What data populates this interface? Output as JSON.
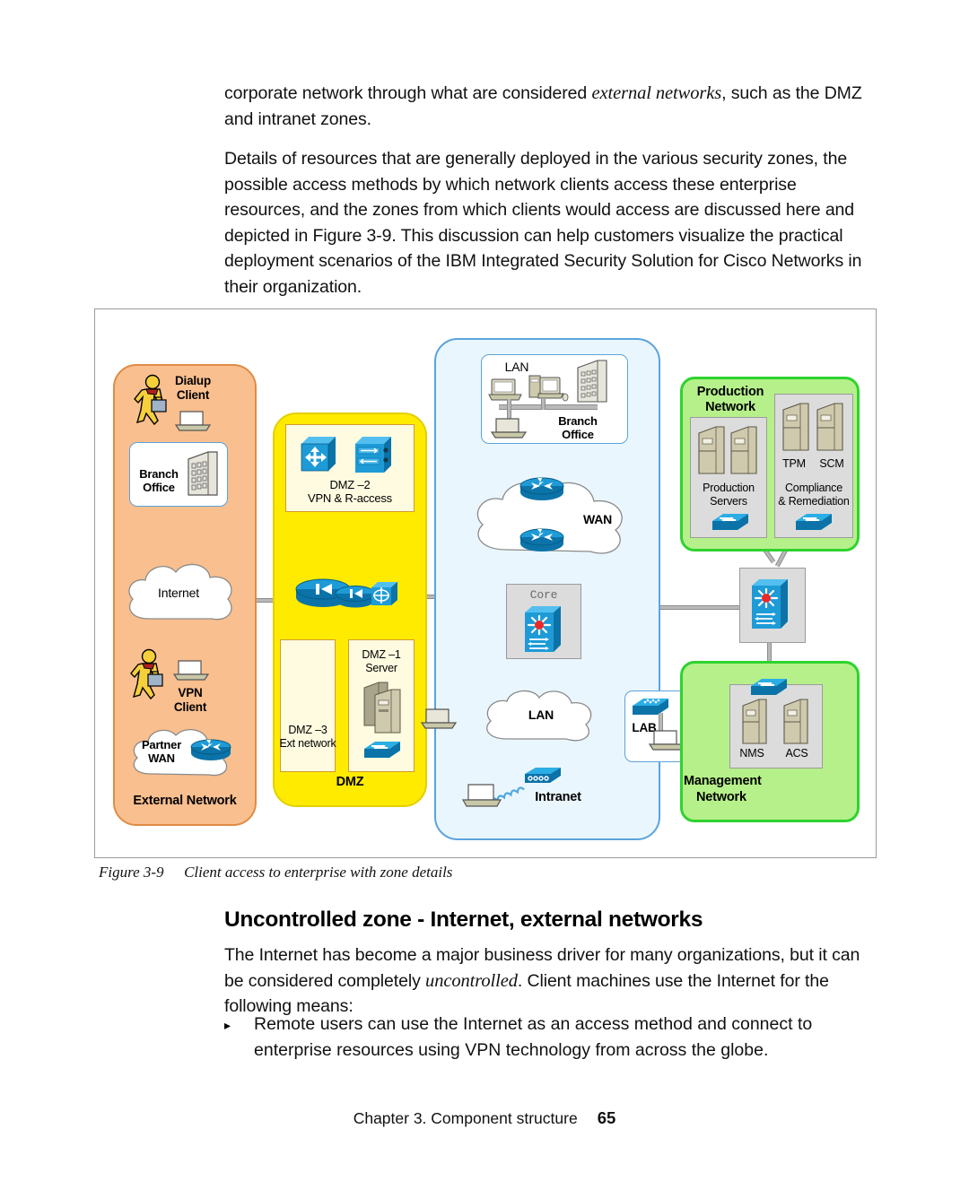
{
  "body": {
    "para1_pre": "corporate network through what are considered ",
    "para1_em": "external networks",
    "para1_post": ", such as the DMZ and intranet zones.",
    "para2": "Details of resources that are generally deployed in the various security zones, the possible access methods by which network clients access these enterprise resources, and the zones from which clients would access are discussed here and depicted in Figure 3-9. This discussion can help customers visualize the practical deployment scenarios of the IBM Integrated Security Solution for Cisco Networks in their organization.",
    "heading": "Uncontrolled zone - Internet, external networks",
    "para3_pre": "The Internet has become a major business driver for many organizations, but it can be considered completely ",
    "para3_em": "uncontrolled",
    "para3_post": ". Client machines use the Internet for the following means:",
    "bullet_marker": "▸",
    "bullet1": "Remote users can use the Internet as an access method and connect to enterprise resources using VPN technology from across the globe."
  },
  "figure": {
    "caption_number": "Figure 3-9",
    "caption_text": "Client access to enterprise with zone details"
  },
  "footer": {
    "chapter": "Chapter 3. Component structure",
    "page": "65"
  },
  "diagram": {
    "zones": {
      "external": {
        "label": "External Network",
        "fill": "#f9bf8f",
        "stroke": "#e08b45"
      },
      "dmz": {
        "label": "DMZ",
        "fill": "#ffeb00",
        "stroke": "#e3cf00"
      },
      "intranet": {
        "label": "Intranet",
        "fill": "#eaf6fd",
        "stroke": "#5ba3dd"
      },
      "production": {
        "label_line1": "Production",
        "label_line2": "Network",
        "fill": "#b6f08a",
        "stroke": "#2fd32f"
      },
      "management": {
        "label_line1": "Management",
        "label_line2": "Network",
        "fill": "#b6f08a",
        "stroke": "#2fd32f"
      }
    },
    "external": {
      "dialup_client_l1": "Dialup",
      "dialup_client_l2": "Client",
      "branch_office_l1": "Branch",
      "branch_office_l2": "Office",
      "internet": "Internet",
      "vpn_client_l1": "VPN",
      "vpn_client_l2": "Client",
      "partner_wan_l1": "Partner",
      "partner_wan_l2": "WAN"
    },
    "dmz": {
      "dmz2_l1": "DMZ –2",
      "dmz2_l2": "VPN & R-access",
      "dmz1_l1": "DMZ –1",
      "dmz1_l2": "Server",
      "dmz3_l1": "DMZ –3",
      "dmz3_l2": "Ext network"
    },
    "intranet": {
      "lan_top": "LAN",
      "branch_office_l1": "Branch",
      "branch_office_l2": "Office",
      "wan": "WAN",
      "core": "Core",
      "lan_bottom": "LAN",
      "lab": "LAB"
    },
    "production": {
      "production_servers_l1": "Production",
      "production_servers_l2": "Servers",
      "tpm": "TPM",
      "scm": "SCM",
      "compliance_l1": "Compliance",
      "compliance_l2": "& Remediation"
    },
    "management": {
      "nms": "NMS",
      "acs": "ACS"
    }
  }
}
